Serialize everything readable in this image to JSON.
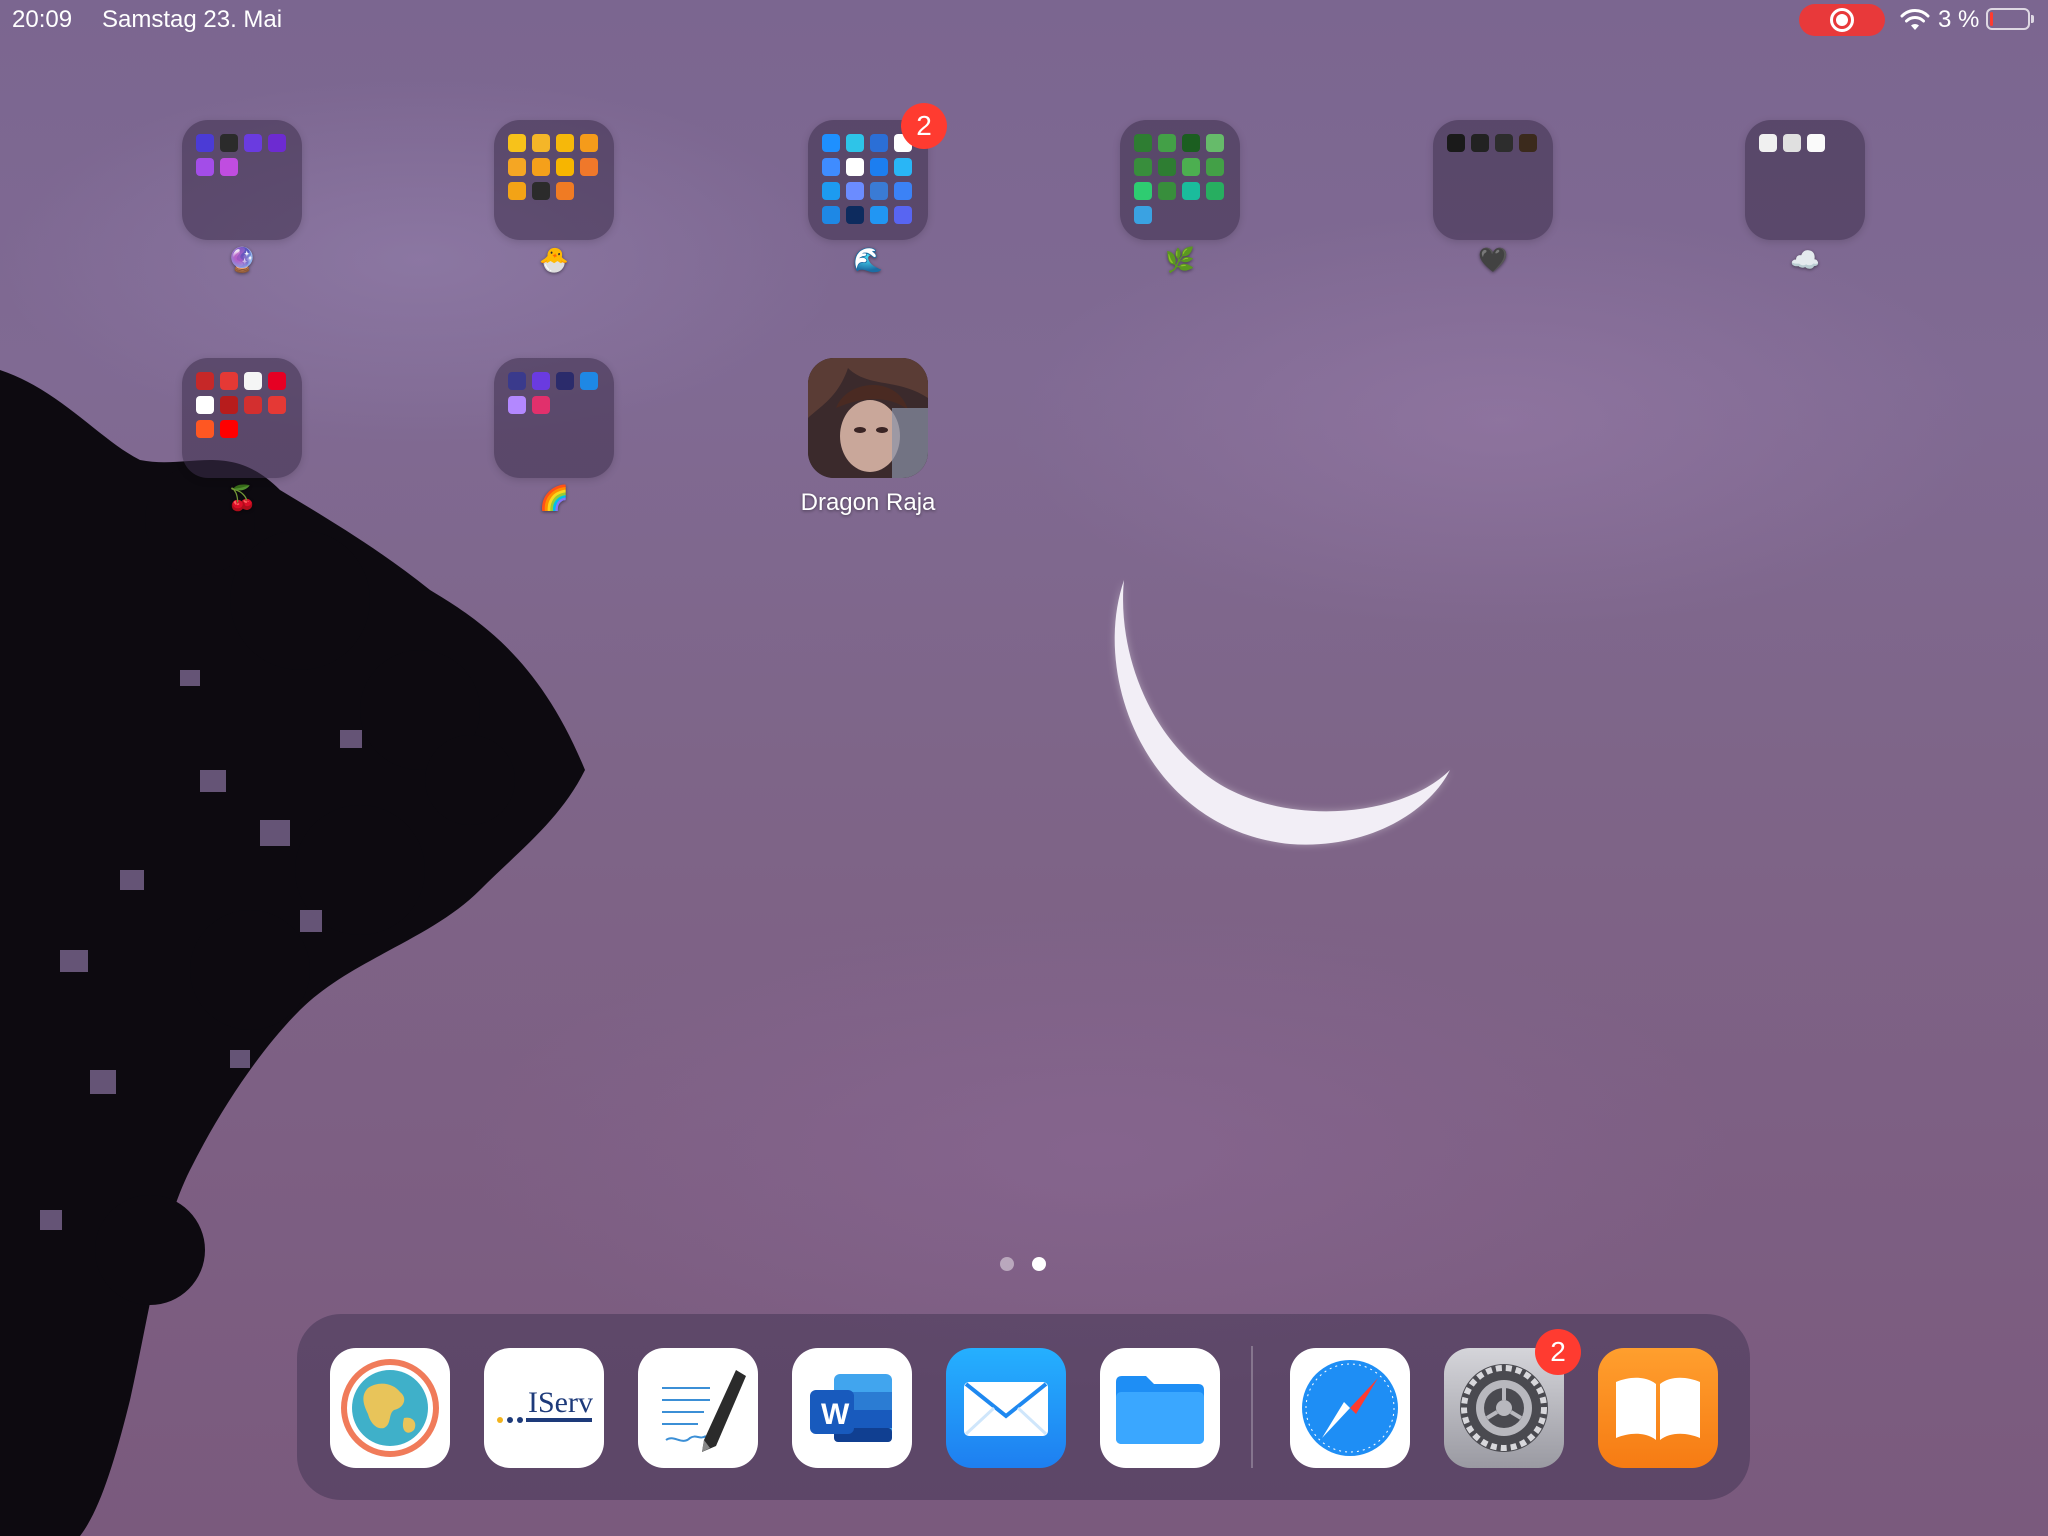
{
  "status_bar": {
    "time": "20:09",
    "date": "Samstag 23. Mai",
    "battery": "3 %",
    "battery_level": 0.03,
    "icons": [
      "screen-recording-icon",
      "wifi-icon",
      "battery-icon"
    ]
  },
  "home": {
    "folders": [
      {
        "label": "🔮",
        "badge": "",
        "minis": [
          "#4b3bd6",
          "#2b2b2b",
          "#6a3be0",
          "#6d2bd1",
          "#a34de8",
          "#c04de0"
        ]
      },
      {
        "label": "🐣",
        "badge": "",
        "minis": [
          "#f7c21a",
          "#f4b628",
          "#f6b80a",
          "#f59b1a",
          "#f5a623",
          "#f5a01a",
          "#f7b500",
          "#f0782a",
          "#f3a316",
          "#2b2b2b",
          "#f07b23"
        ]
      },
      {
        "label": "🌊",
        "badge": "2",
        "minis": [
          "#1e90ff",
          "#2ec4e8",
          "#2b6fd6",
          "#ffffff",
          "#3f8cff",
          "#ffffff",
          "#1c7ef0",
          "#29b6f6",
          "#1d9bf0",
          "#6b8cff",
          "#3a7bd5",
          "#3b82f6",
          "#1e88e5",
          "#0d2b5e",
          "#2196f3",
          "#5865f2"
        ]
      },
      {
        "label": "🌿",
        "badge": "",
        "minis": [
          "#2e7d32",
          "#43a047",
          "#1b5e20",
          "#66bb6a",
          "#388e3c",
          "#2e7d32",
          "#4caf50",
          "#43a047",
          "#2ecc71",
          "#388e3c",
          "#1abc9c",
          "#27ae60",
          "#3aa2e2"
        ]
      },
      {
        "label": "🖤",
        "badge": "",
        "minis": [
          "#1a1a1a",
          "#222222",
          "#2d2d2d",
          "#3b2a1c"
        ]
      },
      {
        "label": "☁️",
        "badge": "",
        "minis": [
          "#f0f0f0",
          "#e0e0e0",
          "#fafafa"
        ]
      },
      {
        "label": "🍒",
        "badge": "",
        "minis": [
          "#c62828",
          "#e53935",
          "#f5f5f5",
          "#e60023",
          "#ffffff",
          "#b71c1c",
          "#d32f2f",
          "#e53935",
          "#ff5722",
          "#ff0000"
        ]
      },
      {
        "label": "🌈",
        "badge": "",
        "minis": [
          "#3a3a8c",
          "#6a3be0",
          "#2b2b6b",
          "#1e88e5",
          "#b388ff",
          "#e1306c"
        ]
      }
    ],
    "app": {
      "label": "Dragon Raja"
    }
  },
  "page_indicator": {
    "pages": 2,
    "current": 2
  },
  "dock": {
    "apps": [
      {
        "name": "Google Earth"
      },
      {
        "name": "IServ",
        "text": "IServ"
      },
      {
        "name": "Notes"
      },
      {
        "name": "Microsoft Word",
        "text": "W"
      },
      {
        "name": "Mail"
      },
      {
        "name": "Files"
      },
      {
        "name": "Safari"
      },
      {
        "name": "Settings",
        "badge": "2"
      },
      {
        "name": "Books"
      }
    ]
  },
  "colors": {
    "accent_badge": "#ff3b30",
    "recording": "#e8393a",
    "mail": "#1e90ff",
    "books": "#f7882f",
    "word": "#2b5cbf"
  }
}
